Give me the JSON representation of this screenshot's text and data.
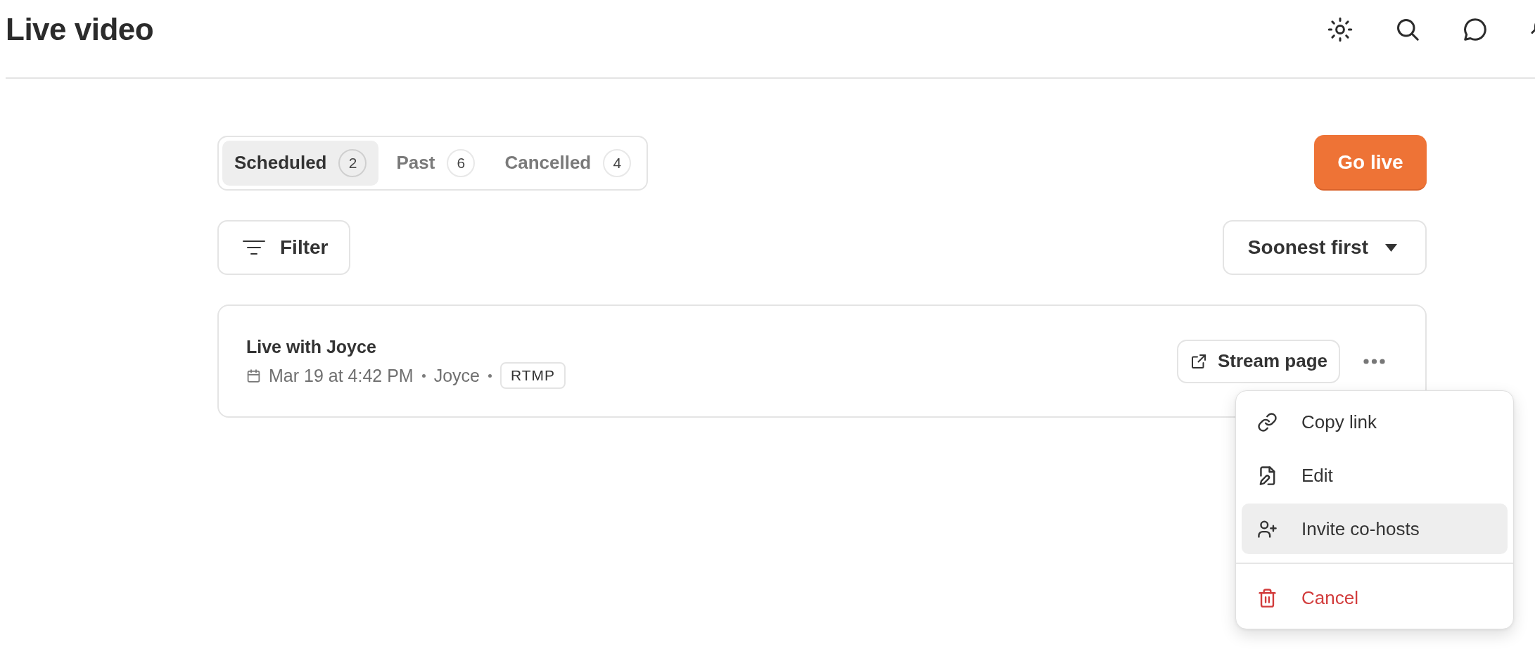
{
  "header": {
    "title": "Live video"
  },
  "tabs": [
    {
      "label": "Scheduled",
      "count": "2",
      "selected": true
    },
    {
      "label": "Past",
      "count": "6",
      "selected": false
    },
    {
      "label": "Cancelled",
      "count": "4",
      "selected": false
    }
  ],
  "go_live_button": {
    "label": "Go live"
  },
  "filter_button": {
    "label": "Filter"
  },
  "sort_dropdown": {
    "value": "Soonest first"
  },
  "streams": [
    {
      "title": "Live with Joyce",
      "date": "Mar 19 at 4:42 PM",
      "host": "Joyce",
      "tag": "RTMP",
      "stream_page_button": "Stream page",
      "menu": {
        "open": true,
        "items": [
          {
            "label": "Copy link",
            "kind": "normal",
            "selected": false
          },
          {
            "label": "Edit",
            "kind": "normal",
            "selected": false
          },
          {
            "label": "Invite co-hosts",
            "kind": "normal",
            "selected": true
          },
          {
            "label": "Cancel",
            "kind": "danger",
            "selected": false
          }
        ]
      }
    }
  ]
}
